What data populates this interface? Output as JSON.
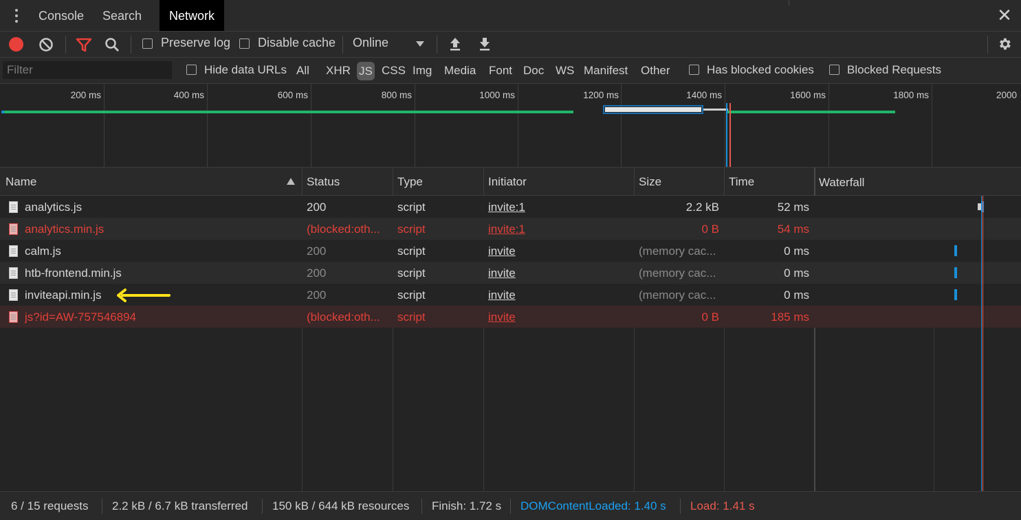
{
  "tabs": [
    {
      "label": "Console"
    },
    {
      "label": "Search"
    },
    {
      "label": "Network"
    }
  ],
  "toolbar": {
    "preserve_log": "Preserve log",
    "disable_cache": "Disable cache",
    "throttle": "Online"
  },
  "filter": {
    "placeholder": "Filter",
    "hide_data_urls": "Hide data URLs",
    "types": [
      "All",
      "XHR",
      "JS",
      "CSS",
      "Img",
      "Media",
      "Font",
      "Doc",
      "WS",
      "Manifest",
      "Other"
    ],
    "selected_type": "JS",
    "has_blocked_cookies": "Has blocked cookies",
    "blocked_requests": "Blocked Requests"
  },
  "overview": {
    "ticks": [
      "200 ms",
      "400 ms",
      "600 ms",
      "800 ms",
      "1000 ms",
      "1200 ms",
      "1400 ms",
      "1600 ms",
      "1800 ms",
      "2000"
    ]
  },
  "columns": {
    "name": "Name",
    "status": "Status",
    "type": "Type",
    "initiator": "Initiator",
    "size": "Size",
    "time": "Time",
    "waterfall": "Waterfall"
  },
  "rows": [
    {
      "name": "analytics.js",
      "status": "200",
      "type": "script",
      "initiator": "invite:1",
      "size": "2.2 kB",
      "time": "52 ms"
    },
    {
      "name": "analytics.min.js",
      "status": "(blocked:oth...",
      "type": "script",
      "initiator": "invite:1",
      "size": "0 B",
      "time": "54 ms"
    },
    {
      "name": "calm.js",
      "status": "200",
      "type": "script",
      "initiator": "invite",
      "size": "(memory cac...",
      "time": "0 ms"
    },
    {
      "name": "htb-frontend.min.js",
      "status": "200",
      "type": "script",
      "initiator": "invite",
      "size": "(memory cac...",
      "time": "0 ms"
    },
    {
      "name": "inviteapi.min.js",
      "status": "200",
      "type": "script",
      "initiator": "invite",
      "size": "(memory cac...",
      "time": "0 ms"
    },
    {
      "name": "js?id=AW-757546894",
      "status": "(blocked:oth...",
      "type": "script",
      "initiator": "invite",
      "size": "0 B",
      "time": "185 ms"
    }
  ],
  "statusbar": {
    "requests": "6 / 15 requests",
    "transferred": "2.2 kB / 6.7 kB transferred",
    "resources": "150 kB / 644 kB resources",
    "finish": "Finish: 1.72 s",
    "dom_content_loaded": "DOMContentLoaded: 1.40 s",
    "load": "Load: 1.41 s"
  },
  "colors": {
    "record": "#e8403a",
    "error_text": "#e0413a",
    "dom_content_loaded": "#1ba1f2",
    "load": "#e85a4f",
    "arrow": "#ffe21a"
  }
}
